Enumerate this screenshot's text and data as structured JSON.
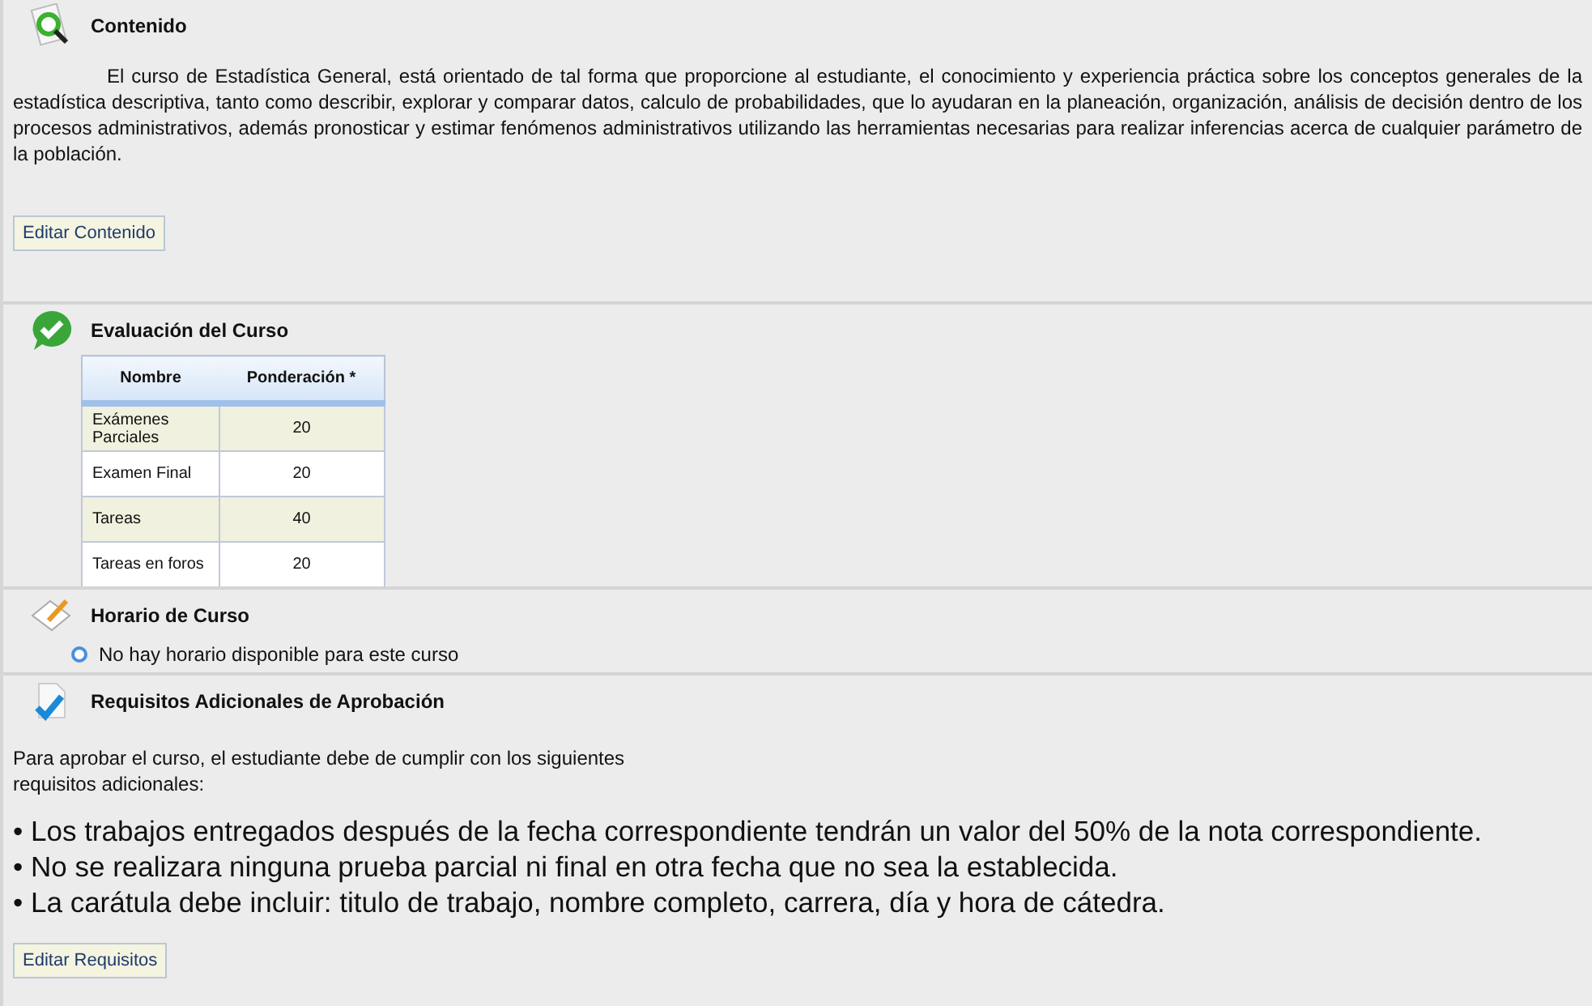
{
  "sections": [
    {
      "kind": "text",
      "title": "Contenido",
      "paragraph": "El curso de Estadística General, está orientado de tal forma que  proporcione al estudiante, el conocimiento y experiencia práctica sobre los  conceptos generales de la estadística descriptiva, tanto como describir, explorar y comparar datos, calculo de probabilidades, que lo ayudaran en la planeación, organización, análisis de decisión dentro de los procesos administrativos, además pronosticar y estimar fenómenos administrativos utilizando las herramientas necesarias para realizar inferencias acerca de cualquier parámetro de la población.",
      "button": "Editar Contenido"
    },
    {
      "kind": "table",
      "title": "Evaluación del Curso",
      "columns": [
        "Nombre",
        "Ponderación *"
      ],
      "rows": [
        [
          "Exámenes Parciales",
          "20"
        ],
        [
          "Examen Final",
          "20"
        ],
        [
          "Tareas",
          "40"
        ],
        [
          "Tareas en foros",
          "20"
        ]
      ]
    },
    {
      "kind": "schedule",
      "title": "Horario de Curso",
      "note": "No hay horario disponible para este curso"
    },
    {
      "kind": "requirements",
      "title": "Requisitos Adicionales de Aprobación",
      "intro": [
        "Para aprobar el curso, el estudiante debe de cumplir con los siguientes",
        "requisitos adicionales:"
      ],
      "items": [
        "• Los trabajos entregados después de la fecha correspondiente tendrán un valor del 50% de la nota correspondiente.",
        "• No se realizara ninguna prueba parcial ni final en otra fecha que no sea la establecida.",
        "• La carátula debe incluir: titulo de trabajo, nombre completo, carrera, día y hora de cátedra."
      ],
      "button": "Editar Requisitos"
    }
  ]
}
